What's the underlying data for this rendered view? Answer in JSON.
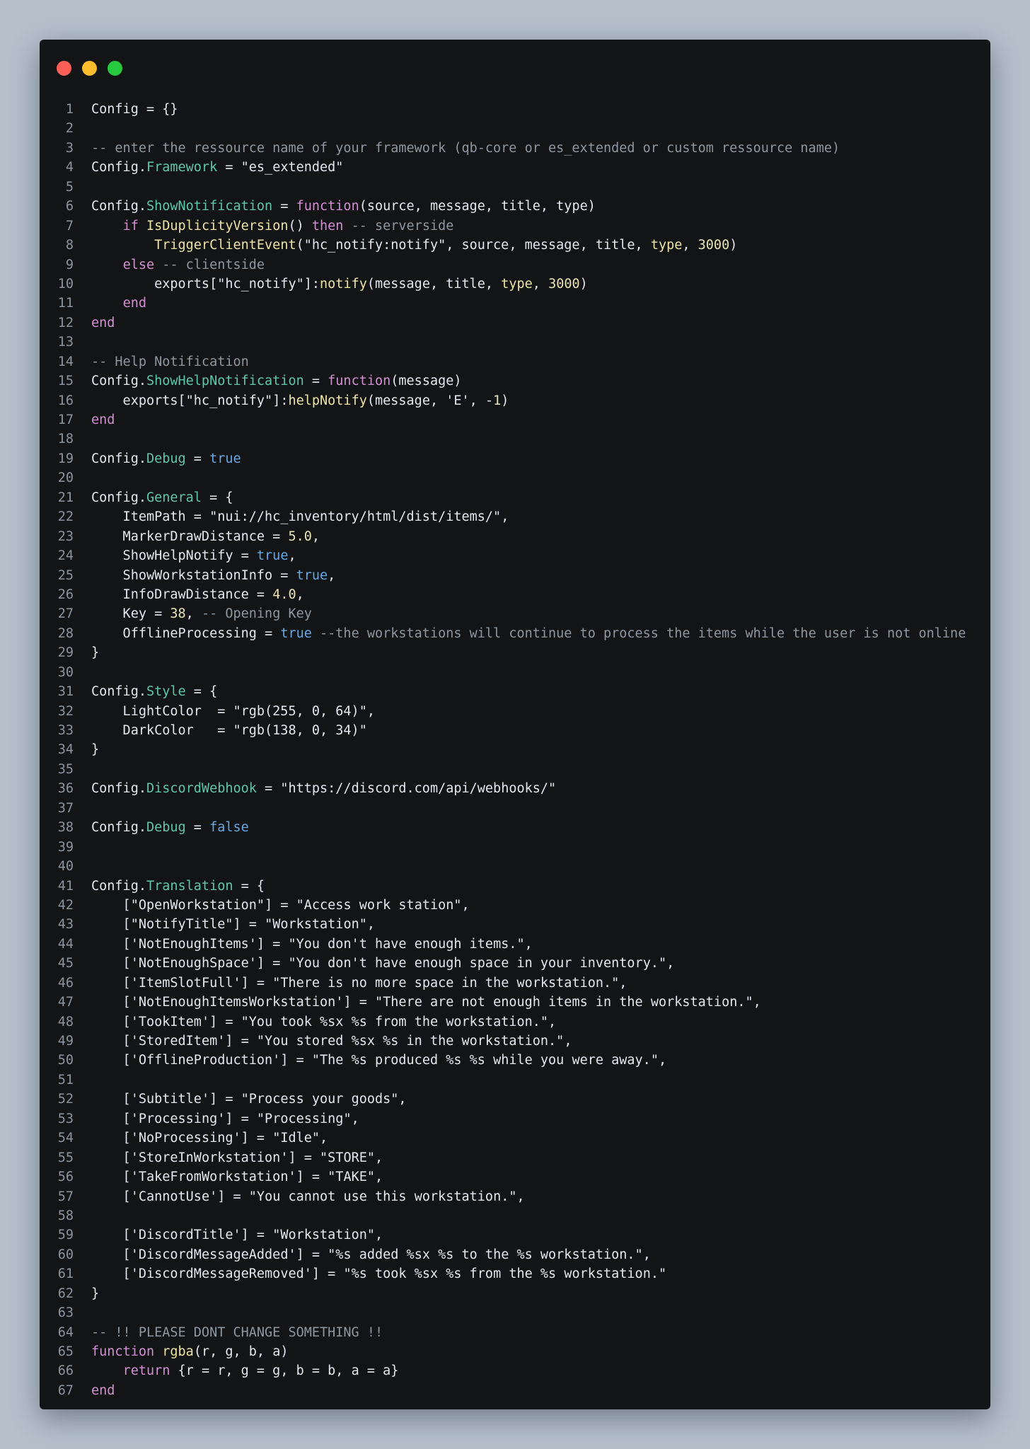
{
  "window": {
    "controls": [
      "close",
      "minimize",
      "maximize"
    ],
    "colors": {
      "background": "#121416",
      "close": "#ff5f56",
      "minimize": "#ffbd2e",
      "maximize": "#27c93f"
    }
  },
  "code": {
    "language": "lua",
    "lines": [
      {
        "n": "1",
        "tokens": [
          [
            "plain",
            "Config = {}"
          ]
        ]
      },
      {
        "n": "2",
        "tokens": []
      },
      {
        "n": "3",
        "tokens": [
          [
            "com",
            "-- enter the ressource name of your framework (qb-core or es_extended or custom ressource name)"
          ]
        ]
      },
      {
        "n": "4",
        "tokens": [
          [
            "plain",
            "Config."
          ],
          [
            "prop",
            "Framework"
          ],
          [
            "plain",
            " = "
          ],
          [
            "str",
            "\"es_extended\""
          ]
        ]
      },
      {
        "n": "5",
        "tokens": []
      },
      {
        "n": "6",
        "tokens": [
          [
            "plain",
            "Config."
          ],
          [
            "prop",
            "ShowNotification"
          ],
          [
            "plain",
            " = "
          ],
          [
            "kw",
            "function"
          ],
          [
            "plain",
            "(source, message, title, type)"
          ]
        ]
      },
      {
        "n": "7",
        "tokens": [
          [
            "plain",
            "    "
          ],
          [
            "kw",
            "if"
          ],
          [
            "plain",
            " "
          ],
          [
            "fn",
            "IsDuplicityVersion"
          ],
          [
            "plain",
            "() "
          ],
          [
            "kw",
            "then"
          ],
          [
            "plain",
            " "
          ],
          [
            "com",
            "-- serverside"
          ]
        ]
      },
      {
        "n": "8",
        "tokens": [
          [
            "plain",
            "        "
          ],
          [
            "fn",
            "TriggerClientEvent"
          ],
          [
            "plain",
            "("
          ],
          [
            "str",
            "\"hc_notify:notify\""
          ],
          [
            "plain",
            ", source, message, title, "
          ],
          [
            "fn",
            "type"
          ],
          [
            "plain",
            ", "
          ],
          [
            "num",
            "3000"
          ],
          [
            "plain",
            ")"
          ]
        ]
      },
      {
        "n": "9",
        "tokens": [
          [
            "plain",
            "    "
          ],
          [
            "kw",
            "else"
          ],
          [
            "plain",
            " "
          ],
          [
            "com",
            "-- clientside"
          ]
        ]
      },
      {
        "n": "10",
        "tokens": [
          [
            "plain",
            "        exports["
          ],
          [
            "str",
            "\"hc_notify\""
          ],
          [
            "plain",
            "]:"
          ],
          [
            "fn",
            "notify"
          ],
          [
            "plain",
            "(message, title, "
          ],
          [
            "fn",
            "type"
          ],
          [
            "plain",
            ", "
          ],
          [
            "num",
            "3000"
          ],
          [
            "plain",
            ")"
          ]
        ]
      },
      {
        "n": "11",
        "tokens": [
          [
            "plain",
            "    "
          ],
          [
            "kw",
            "end"
          ]
        ]
      },
      {
        "n": "12",
        "tokens": [
          [
            "kw",
            "end"
          ]
        ]
      },
      {
        "n": "13",
        "tokens": []
      },
      {
        "n": "14",
        "tokens": [
          [
            "com",
            "-- Help Notification"
          ]
        ]
      },
      {
        "n": "15",
        "tokens": [
          [
            "plain",
            "Config."
          ],
          [
            "prop",
            "ShowHelpNotification"
          ],
          [
            "plain",
            " = "
          ],
          [
            "kw",
            "function"
          ],
          [
            "plain",
            "(message)"
          ]
        ]
      },
      {
        "n": "16",
        "tokens": [
          [
            "plain",
            "    exports["
          ],
          [
            "str",
            "\"hc_notify\""
          ],
          [
            "plain",
            "]:"
          ],
          [
            "fn",
            "helpNotify"
          ],
          [
            "plain",
            "(message, "
          ],
          [
            "str",
            "'E'"
          ],
          [
            "plain",
            ", -"
          ],
          [
            "num",
            "1"
          ],
          [
            "plain",
            ")"
          ]
        ]
      },
      {
        "n": "17",
        "tokens": [
          [
            "kw",
            "end"
          ]
        ]
      },
      {
        "n": "18",
        "tokens": []
      },
      {
        "n": "19",
        "tokens": [
          [
            "plain",
            "Config."
          ],
          [
            "prop",
            "Debug"
          ],
          [
            "plain",
            " = "
          ],
          [
            "bool",
            "true"
          ]
        ]
      },
      {
        "n": "20",
        "tokens": []
      },
      {
        "n": "21",
        "tokens": [
          [
            "plain",
            "Config."
          ],
          [
            "prop",
            "General"
          ],
          [
            "plain",
            " = {"
          ]
        ]
      },
      {
        "n": "22",
        "tokens": [
          [
            "plain",
            "    ItemPath = "
          ],
          [
            "str",
            "\"nui://hc_inventory/html/dist/items/\""
          ],
          [
            "plain",
            ","
          ]
        ]
      },
      {
        "n": "23",
        "tokens": [
          [
            "plain",
            "    MarkerDrawDistance = "
          ],
          [
            "num",
            "5.0"
          ],
          [
            "plain",
            ","
          ]
        ]
      },
      {
        "n": "24",
        "tokens": [
          [
            "plain",
            "    ShowHelpNotify = "
          ],
          [
            "bool",
            "true"
          ],
          [
            "plain",
            ","
          ]
        ]
      },
      {
        "n": "25",
        "tokens": [
          [
            "plain",
            "    ShowWorkstationInfo = "
          ],
          [
            "bool",
            "true"
          ],
          [
            "plain",
            ","
          ]
        ]
      },
      {
        "n": "26",
        "tokens": [
          [
            "plain",
            "    InfoDrawDistance = "
          ],
          [
            "num",
            "4.0"
          ],
          [
            "plain",
            ","
          ]
        ]
      },
      {
        "n": "27",
        "tokens": [
          [
            "plain",
            "    Key = "
          ],
          [
            "num",
            "38"
          ],
          [
            "plain",
            ", "
          ],
          [
            "com",
            "-- Opening Key"
          ]
        ]
      },
      {
        "n": "28",
        "tokens": [
          [
            "plain",
            "    OfflineProcessing = "
          ],
          [
            "bool",
            "true"
          ],
          [
            "plain",
            " "
          ],
          [
            "com",
            "--the workstations will continue to process the items while the user is not online"
          ]
        ]
      },
      {
        "n": "29",
        "tokens": [
          [
            "plain",
            "}"
          ]
        ]
      },
      {
        "n": "30",
        "tokens": []
      },
      {
        "n": "31",
        "tokens": [
          [
            "plain",
            "Config."
          ],
          [
            "prop",
            "Style"
          ],
          [
            "plain",
            " = {"
          ]
        ]
      },
      {
        "n": "32",
        "tokens": [
          [
            "plain",
            "    LightColor  = "
          ],
          [
            "str",
            "\"rgb(255, 0, 64)\""
          ],
          [
            "plain",
            ","
          ]
        ]
      },
      {
        "n": "33",
        "tokens": [
          [
            "plain",
            "    DarkColor   = "
          ],
          [
            "str",
            "\"rgb(138, 0, 34)\""
          ]
        ]
      },
      {
        "n": "34",
        "tokens": [
          [
            "plain",
            "}"
          ]
        ]
      },
      {
        "n": "35",
        "tokens": []
      },
      {
        "n": "36",
        "tokens": [
          [
            "plain",
            "Config."
          ],
          [
            "prop",
            "DiscordWebhook"
          ],
          [
            "plain",
            " = "
          ],
          [
            "str",
            "\"https://discord.com/api/webhooks/\""
          ]
        ]
      },
      {
        "n": "37",
        "tokens": []
      },
      {
        "n": "38",
        "tokens": [
          [
            "plain",
            "Config."
          ],
          [
            "prop",
            "Debug"
          ],
          [
            "plain",
            " = "
          ],
          [
            "bool",
            "false"
          ]
        ]
      },
      {
        "n": "39",
        "tokens": []
      },
      {
        "n": "40",
        "tokens": []
      },
      {
        "n": "41",
        "tokens": [
          [
            "plain",
            "Config."
          ],
          [
            "prop",
            "Translation"
          ],
          [
            "plain",
            " = {"
          ]
        ]
      },
      {
        "n": "42",
        "tokens": [
          [
            "plain",
            "    ["
          ],
          [
            "str",
            "\"OpenWorkstation\""
          ],
          [
            "plain",
            "] = "
          ],
          [
            "str",
            "\"Access work station\""
          ],
          [
            "plain",
            ","
          ]
        ]
      },
      {
        "n": "43",
        "tokens": [
          [
            "plain",
            "    ["
          ],
          [
            "str",
            "\"NotifyTitle\""
          ],
          [
            "plain",
            "] = "
          ],
          [
            "str",
            "\"Workstation\""
          ],
          [
            "plain",
            ","
          ]
        ]
      },
      {
        "n": "44",
        "tokens": [
          [
            "plain",
            "    ["
          ],
          [
            "str",
            "'NotEnoughItems'"
          ],
          [
            "plain",
            "] = "
          ],
          [
            "str",
            "\"You don't have enough items.\""
          ],
          [
            "plain",
            ","
          ]
        ]
      },
      {
        "n": "45",
        "tokens": [
          [
            "plain",
            "    ["
          ],
          [
            "str",
            "'NotEnoughSpace'"
          ],
          [
            "plain",
            "] = "
          ],
          [
            "str",
            "\"You don't have enough space in your inventory.\""
          ],
          [
            "plain",
            ","
          ]
        ]
      },
      {
        "n": "46",
        "tokens": [
          [
            "plain",
            "    ["
          ],
          [
            "str",
            "'ItemSlotFull'"
          ],
          [
            "plain",
            "] = "
          ],
          [
            "str",
            "\"There is no more space in the workstation.\""
          ],
          [
            "plain",
            ","
          ]
        ]
      },
      {
        "n": "47",
        "tokens": [
          [
            "plain",
            "    ["
          ],
          [
            "str",
            "'NotEnoughItemsWorkstation'"
          ],
          [
            "plain",
            "] = "
          ],
          [
            "str",
            "\"There are not enough items in the workstation.\""
          ],
          [
            "plain",
            ","
          ]
        ]
      },
      {
        "n": "48",
        "tokens": [
          [
            "plain",
            "    ["
          ],
          [
            "str",
            "'TookItem'"
          ],
          [
            "plain",
            "] = "
          ],
          [
            "str",
            "\"You took %sx %s from the workstation.\""
          ],
          [
            "plain",
            ","
          ]
        ]
      },
      {
        "n": "49",
        "tokens": [
          [
            "plain",
            "    ["
          ],
          [
            "str",
            "'StoredItem'"
          ],
          [
            "plain",
            "] = "
          ],
          [
            "str",
            "\"You stored %sx %s in the workstation.\""
          ],
          [
            "plain",
            ","
          ]
        ]
      },
      {
        "n": "50",
        "tokens": [
          [
            "plain",
            "    ["
          ],
          [
            "str",
            "'OfflineProduction'"
          ],
          [
            "plain",
            "] = "
          ],
          [
            "str",
            "\"The %s produced %s %s while you were away.\""
          ],
          [
            "plain",
            ","
          ]
        ]
      },
      {
        "n": "51",
        "tokens": []
      },
      {
        "n": "52",
        "tokens": [
          [
            "plain",
            "    ["
          ],
          [
            "str",
            "'Subtitle'"
          ],
          [
            "plain",
            "] = "
          ],
          [
            "str",
            "\"Process your goods\""
          ],
          [
            "plain",
            ","
          ]
        ]
      },
      {
        "n": "53",
        "tokens": [
          [
            "plain",
            "    ["
          ],
          [
            "str",
            "'Processing'"
          ],
          [
            "plain",
            "] = "
          ],
          [
            "str",
            "\"Processing\""
          ],
          [
            "plain",
            ","
          ]
        ]
      },
      {
        "n": "54",
        "tokens": [
          [
            "plain",
            "    ["
          ],
          [
            "str",
            "'NoProcessing'"
          ],
          [
            "plain",
            "] = "
          ],
          [
            "str",
            "\"Idle\""
          ],
          [
            "plain",
            ","
          ]
        ]
      },
      {
        "n": "55",
        "tokens": [
          [
            "plain",
            "    ["
          ],
          [
            "str",
            "'StoreInWorkstation'"
          ],
          [
            "plain",
            "] = "
          ],
          [
            "str",
            "\"STORE\""
          ],
          [
            "plain",
            ","
          ]
        ]
      },
      {
        "n": "56",
        "tokens": [
          [
            "plain",
            "    ["
          ],
          [
            "str",
            "'TakeFromWorkstation'"
          ],
          [
            "plain",
            "] = "
          ],
          [
            "str",
            "\"TAKE\""
          ],
          [
            "plain",
            ","
          ]
        ]
      },
      {
        "n": "57",
        "tokens": [
          [
            "plain",
            "    ["
          ],
          [
            "str",
            "'CannotUse'"
          ],
          [
            "plain",
            "] = "
          ],
          [
            "str",
            "\"You cannot use this workstation.\""
          ],
          [
            "plain",
            ","
          ]
        ]
      },
      {
        "n": "58",
        "tokens": []
      },
      {
        "n": "59",
        "tokens": [
          [
            "plain",
            "    ["
          ],
          [
            "str",
            "'DiscordTitle'"
          ],
          [
            "plain",
            "] = "
          ],
          [
            "str",
            "\"Workstation\""
          ],
          [
            "plain",
            ","
          ]
        ]
      },
      {
        "n": "60",
        "tokens": [
          [
            "plain",
            "    ["
          ],
          [
            "str",
            "'DiscordMessageAdded'"
          ],
          [
            "plain",
            "] = "
          ],
          [
            "str",
            "\"%s added %sx %s to the %s workstation.\""
          ],
          [
            "plain",
            ","
          ]
        ]
      },
      {
        "n": "61",
        "tokens": [
          [
            "plain",
            "    ["
          ],
          [
            "str",
            "'DiscordMessageRemoved'"
          ],
          [
            "plain",
            "] = "
          ],
          [
            "str",
            "\"%s took %sx %s from the %s workstation.\""
          ]
        ]
      },
      {
        "n": "62",
        "tokens": [
          [
            "plain",
            "}"
          ]
        ]
      },
      {
        "n": "63",
        "tokens": []
      },
      {
        "n": "64",
        "tokens": [
          [
            "com",
            "-- !! PLEASE DONT CHANGE SOMETHING !!"
          ]
        ]
      },
      {
        "n": "65",
        "tokens": [
          [
            "kw",
            "function"
          ],
          [
            "plain",
            " "
          ],
          [
            "fn",
            "rgba"
          ],
          [
            "plain",
            "(r, g, b, a)"
          ]
        ]
      },
      {
        "n": "66",
        "tokens": [
          [
            "plain",
            "    "
          ],
          [
            "kw",
            "return"
          ],
          [
            "plain",
            " {r = r, g = g, b = b, a = a}"
          ]
        ]
      },
      {
        "n": "67",
        "tokens": [
          [
            "kw",
            "end"
          ]
        ]
      }
    ]
  }
}
